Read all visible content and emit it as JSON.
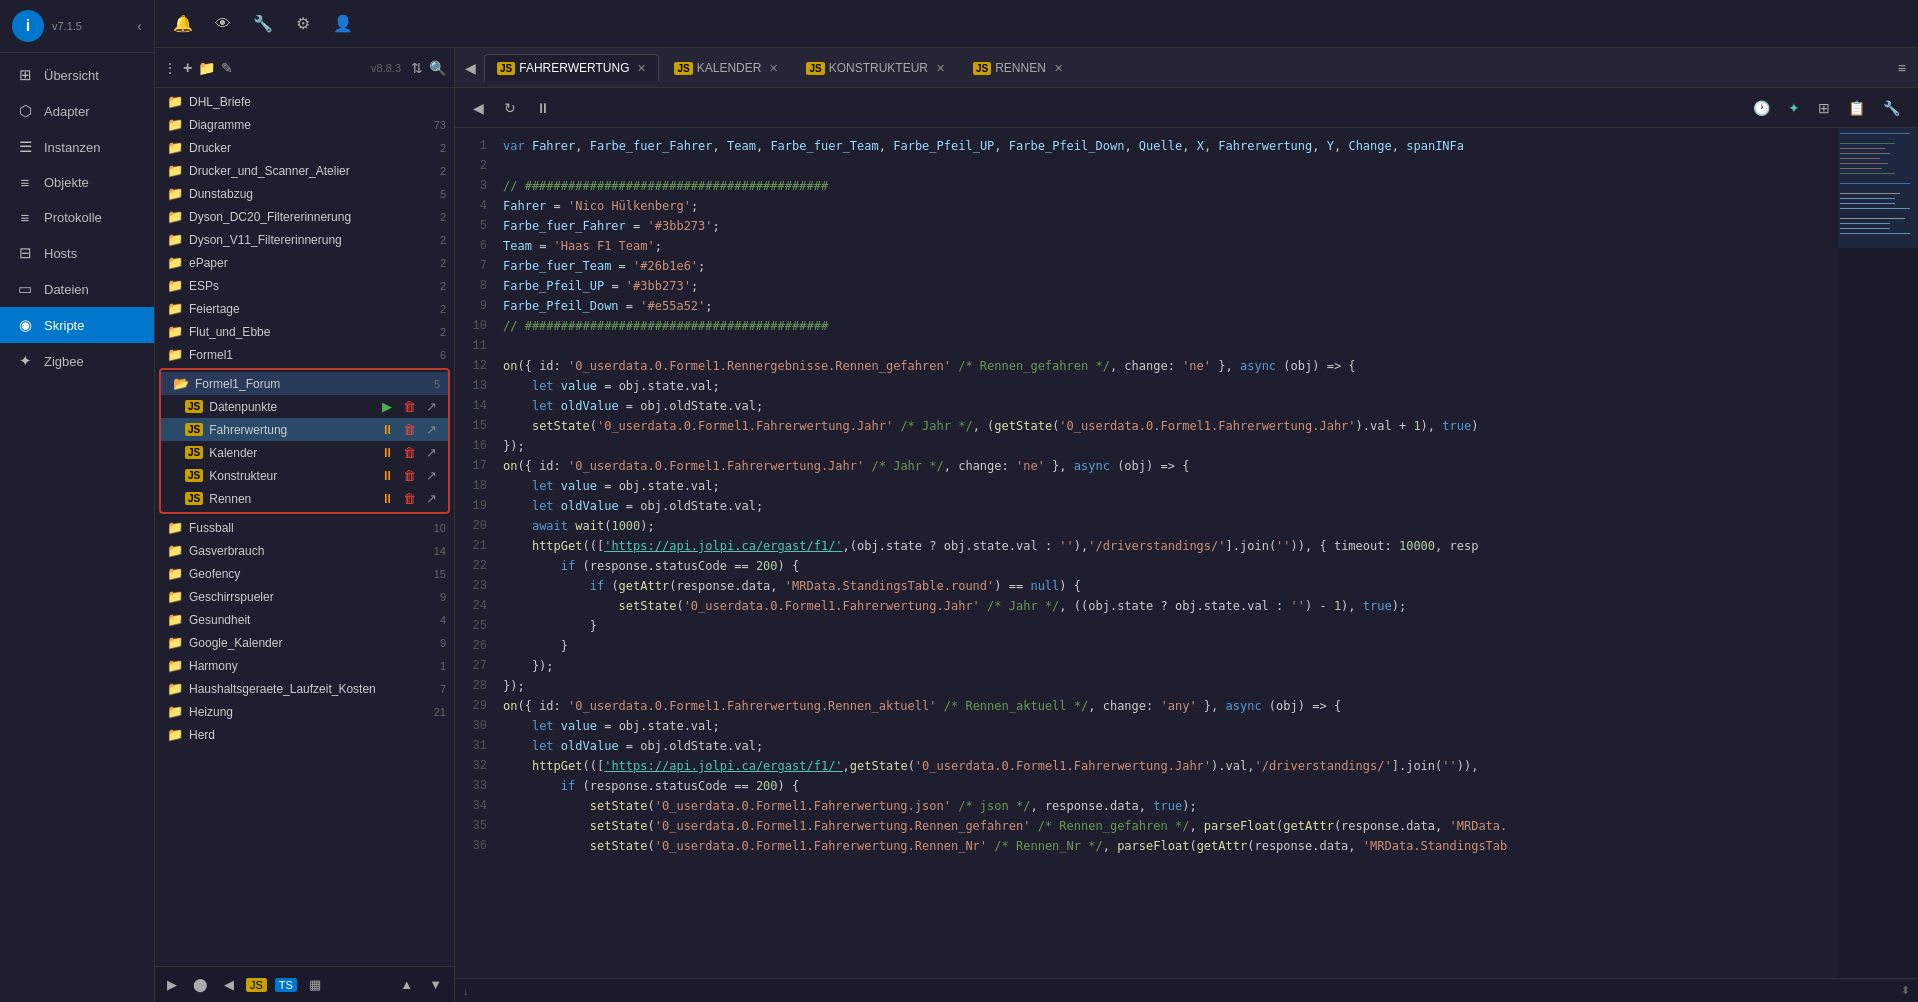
{
  "app": {
    "version": "v7.1.5",
    "logo_letter": "i"
  },
  "sidebar": {
    "collapse_icon": "‹",
    "items": [
      {
        "id": "uebersicht",
        "label": "Übersicht",
        "icon": "⊞",
        "active": false
      },
      {
        "id": "adapter",
        "label": "Adapter",
        "icon": "⬡",
        "active": false
      },
      {
        "id": "instanzen",
        "label": "Instanzen",
        "icon": "☰",
        "active": false
      },
      {
        "id": "objekte",
        "label": "Objekte",
        "icon": "≡",
        "active": false
      },
      {
        "id": "protokolle",
        "label": "Protokolle",
        "icon": "≡",
        "active": false
      },
      {
        "id": "hosts",
        "label": "Hosts",
        "icon": "⊟",
        "active": false
      },
      {
        "id": "dateien",
        "label": "Dateien",
        "icon": "▭",
        "active": false
      },
      {
        "id": "skripte",
        "label": "Skripte",
        "icon": "◉",
        "active": true
      },
      {
        "id": "zigbee",
        "label": "Zigbee",
        "icon": "✦",
        "active": false
      }
    ]
  },
  "toolbar": {
    "icons": [
      "🔔",
      "👁",
      "🔧",
      "⚙",
      "👤"
    ]
  },
  "file_browser": {
    "version": "v8.8.3",
    "actions": {
      "more": "⋮",
      "add": "+",
      "add_folder": "📁",
      "edit": "✎",
      "sort": "⇅",
      "search": "🔍"
    },
    "folders": [
      {
        "name": "DHL_Briefe",
        "count": ""
      },
      {
        "name": "Diagramme",
        "count": "73"
      },
      {
        "name": "Drucker",
        "count": "2"
      },
      {
        "name": "Drucker_und_Scanner_Atelier",
        "count": "2"
      },
      {
        "name": "Dunstabzug",
        "count": "5"
      },
      {
        "name": "Dyson_DC20_Filtererinnerung",
        "count": "2"
      },
      {
        "name": "Dyson_V11_Filtererinnerung",
        "count": "2"
      },
      {
        "name": "ePaper",
        "count": "2"
      },
      {
        "name": "ESPs",
        "count": "2"
      },
      {
        "name": "Feiertage",
        "count": "2"
      },
      {
        "name": "Flut_und_Ebbe",
        "count": "2"
      },
      {
        "name": "Formel1",
        "count": "6"
      },
      {
        "name": "Formel1_Forum",
        "count": "5",
        "expanded": true,
        "selected": true
      },
      {
        "name": "Fussball",
        "count": "10"
      },
      {
        "name": "Gasverbrauch",
        "count": "14"
      },
      {
        "name": "Geofency",
        "count": "15"
      },
      {
        "name": "Geschirrspueler",
        "count": "9"
      },
      {
        "name": "Gesundheit",
        "count": "4"
      },
      {
        "name": "Google_Kalender",
        "count": "9"
      },
      {
        "name": "Harmony",
        "count": "1"
      },
      {
        "name": "Haushaltsgeraete_Laufzeit_Kosten",
        "count": "7"
      },
      {
        "name": "Heizung",
        "count": "21"
      },
      {
        "name": "Herd",
        "count": ""
      }
    ],
    "scripts": [
      {
        "name": "Datenpunkte",
        "active": false
      },
      {
        "name": "Fahrerwertung",
        "active": true
      },
      {
        "name": "Kalender",
        "active": false
      },
      {
        "name": "Konstrukteur",
        "active": false
      },
      {
        "name": "Rennen",
        "active": false
      }
    ]
  },
  "editor": {
    "tabs": [
      {
        "id": "fahrerwertung",
        "label": "FAHRERWERTUNG",
        "active": true
      },
      {
        "id": "kalender",
        "label": "KALENDER",
        "active": false
      },
      {
        "id": "konstrukteur",
        "label": "KONSTRUKTEUR",
        "active": false
      },
      {
        "id": "rennen",
        "label": "RENNEN",
        "active": false
      }
    ],
    "code_lines": [
      "var Fahrer, Farbe_fuer_Fahrer, Team, Farbe_fuer_Team, Farbe_Pfeil_UP, Farbe_Pfeil_Down, Quelle, X, Fahrerwertung, Y, Change, spanINFa",
      "",
      "// ##########################################",
      "Fahrer = 'Nico Hülkenberg';",
      "Farbe_fuer_Fahrer = '#3bb273';",
      "Team = 'Haas F1 Team';",
      "Farbe_fuer_Team = '#26b1e6';",
      "Farbe_Pfeil_UP = '#3bb273';",
      "Farbe_Pfeil_Down = '#e55a52';",
      "// ##########################################",
      "",
      "on({ id: '0_userdata.0.Formel1.Rennergebnisse.Rennen_gefahren' /* Rennen_gefahren */, change: 'ne' }, async (obj) => {",
      "    let value = obj.state.val;",
      "    let oldValue = obj.oldState.val;",
      "    setState('0_userdata.0.Formel1.Fahrerwertung.Jahr' /* Jahr */, (getState('0_userdata.0.Formel1.Fahrerwertung.Jahr').val + 1), true)",
      "});",
      "on({ id: '0_userdata.0.Formel1.Fahrerwertung.Jahr' /* Jahr */, change: 'ne' }, async (obj) => {",
      "    let value = obj.state.val;",
      "    let oldValue = obj.oldState.val;",
      "    await wait(1000);",
      "    httpGet((['https://api.jolpi.ca/ergast/f1/',(obj.state ? obj.state.val : ''),'/driverstandings/'].join('')), { timeout: 10000, resp",
      "        if (response.statusCode == 200) {",
      "            if (getAttr(response.data, 'MRData.StandingsTable.round') == null) {",
      "                setState('0_userdata.0.Formel1.Fahrerwertung.Jahr' /* Jahr */, ((obj.state ? obj.state.val : '') - 1), true);",
      "            }",
      "        }",
      "    });",
      "});",
      "on({ id: '0_userdata.0.Formel1.Fahrerwertung.Rennen_aktuell' /* Rennen_aktuell */, change: 'any' }, async (obj) => {",
      "    let value = obj.state.val;",
      "    let oldValue = obj.oldState.val;",
      "    httpGet((['https://api.jolpi.ca/ergast/f1/',getState('0_userdata.0.Formel1.Fahrerwertung.Jahr').val,'/driverstandings/'].join('')),",
      "        if (response.statusCode == 200) {",
      "            setState('0_userdata.0.Formel1.Fahrerwertung.json' /* json */, response.data, true);",
      "            setState('0_userdata.0.Formel1.Fahrerwertung.Rennen_gefahren' /* Rennen_gefahren */, parseFloat(getAttr(response.data, 'MRData.",
      "            setState('0_userdata.0.Formel1.Fahrerwertung.Rennen_Nr' /* Rennen_Nr */, parseFloat(getAttr(response.data, 'MRData.StandingsTab"
    ],
    "line_count": 36
  },
  "bottom_bar": {
    "icons": [
      "▶",
      "⬤",
      "◀",
      "JS",
      "TS",
      "▦"
    ]
  }
}
